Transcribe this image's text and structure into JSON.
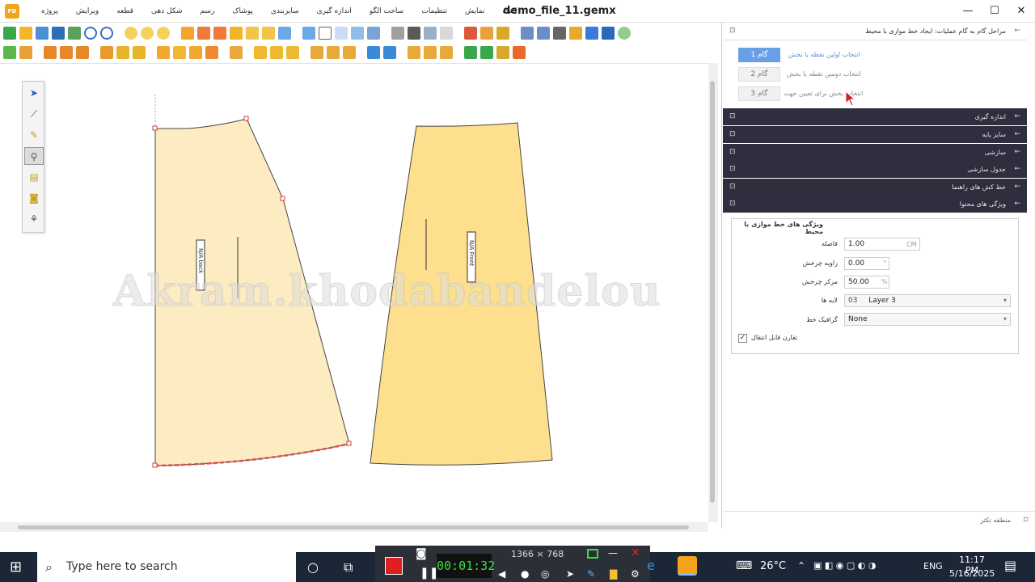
{
  "app": {
    "title": "demo_file_11.gemx",
    "logo_text": "PD"
  },
  "menu": [
    "پروژه",
    "ویرایش",
    "قطعه",
    "شکل دهی",
    "رسم",
    "پوشاک",
    "سایزبندی",
    "اندازه گیری",
    "ساخت الگو",
    "تنظیمات",
    "نمایش",
    "کمک"
  ],
  "window_controls": {
    "minimize": "—",
    "maximize": "☐",
    "close": "✕"
  },
  "canvas": {
    "watermark": "Akram.khodabandelou",
    "piece_back_label": "N/A back",
    "piece_front_label": "N/A Front"
  },
  "right_panel": {
    "header": "مراحل گام به گام عملیات: ایجاد خط موازی با محیط",
    "steps": [
      {
        "button": "گام 1",
        "text": "انتخاب اولین نقطه یا بخش",
        "active": true
      },
      {
        "button": "گام 2",
        "text": "انتخاب دومین نقطه یا بخش",
        "active": false
      },
      {
        "button": "گام 3",
        "text": "انتخاب بخش برای تعیین جهت",
        "active": false
      }
    ],
    "sections": [
      "اندازه گیری",
      "سایز پایه",
      "سازشی",
      "جدول سازشی",
      "خط کش های راهنما",
      "ویژگی های محتوا"
    ],
    "props_title": "ویژگی های خط موازی با محیط",
    "props": {
      "distance": {
        "label": "فاصله",
        "value": "1.00",
        "unit": "CM"
      },
      "angle": {
        "label": "زاویه چرخش",
        "value": "0.00",
        "unit": "°"
      },
      "center": {
        "label": "مرکز چرخش",
        "value": "50.00",
        "unit": "%"
      },
      "layer": {
        "label": "لایه ها",
        "num": "03",
        "value": "Layer 3"
      },
      "graphic": {
        "label": "گرافیک خط",
        "value": "None"
      },
      "checkbox": {
        "label": "تقارن قابل انتقال",
        "checked": true
      }
    },
    "status": "منطقه تکثر"
  },
  "recorder": {
    "time": "00:01:32",
    "resolution": "1366 × 768"
  },
  "taskbar": {
    "search_placeholder": "Type here to search",
    "weather": "26°C",
    "lang": "ENG",
    "time": "11:17 PM",
    "date": "5/16/2025"
  },
  "colors": {
    "piece_back": "#fdecc2",
    "piece_front": "#fddf8e",
    "accent": "#6a9fe8",
    "dark_panel": "#2e2e3e"
  }
}
